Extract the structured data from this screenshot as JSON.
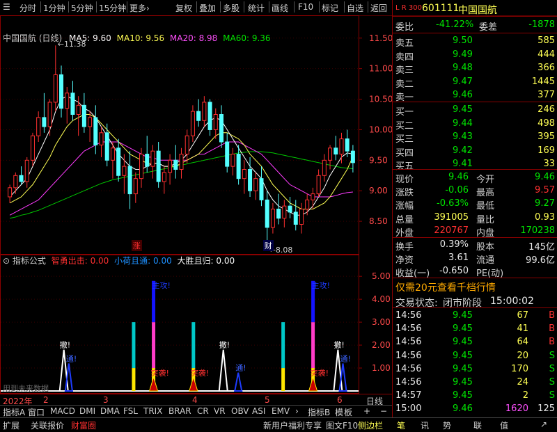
{
  "toolbar": {
    "left": [
      "分时",
      "1分钟",
      "5分钟",
      "15分钟",
      "更多›"
    ],
    "right": [
      "复权",
      "叠加",
      "多股",
      "统计",
      "画线",
      "F10",
      "标记",
      "自选",
      "返回"
    ]
  },
  "chart": {
    "title": "中国国航 (日线)",
    "legend": {
      "ma5": "MA5: 9.60",
      "ma10": "MA10: 9.56",
      "ma20": "MA20: 8.98",
      "ma60": "MA60: 9.36"
    },
    "high_marker": "11.38",
    "low_marker": "8.08",
    "badge_up": "涨",
    "badge_fin": "财",
    "ticks": [
      "11.50",
      "11.00",
      "10.50",
      "10.00",
      "9.50",
      "9.00",
      "8.50"
    ],
    "indicator_title": "指标公式",
    "indicator_legend": {
      "a": "智勇出击: 0.00",
      "b": "小荷且通: 0.00",
      "c": "大胜且归: 0.00"
    },
    "indicator_ticks": [
      "5.00",
      "4.00",
      "3.00",
      "2.00",
      "1.00"
    ],
    "future_note": "用到未来数据",
    "date_axis": [
      "2022年",
      "2",
      "3",
      "4",
      "5",
      "6"
    ],
    "period_label": "日线",
    "pm": [
      "+",
      "−"
    ]
  },
  "chart_data": {
    "type": "candlestick",
    "ylim": [
      8.0,
      11.6
    ],
    "ohlc": [
      [
        8.9,
        9.1,
        8.8,
        9.05
      ],
      [
        9.05,
        9.3,
        8.95,
        9.25
      ],
      [
        9.25,
        9.4,
        9.1,
        9.15
      ],
      [
        9.15,
        9.55,
        9.05,
        9.5
      ],
      [
        9.5,
        9.95,
        9.4,
        9.9
      ],
      [
        9.9,
        10.3,
        9.8,
        10.2
      ],
      [
        10.2,
        10.6,
        9.95,
        10.05
      ],
      [
        10.05,
        10.5,
        9.9,
        10.45
      ],
      [
        10.45,
        11.38,
        10.3,
        10.9
      ],
      [
        10.9,
        11.05,
        10.2,
        10.35
      ],
      [
        10.35,
        10.7,
        10.1,
        10.6
      ],
      [
        10.6,
        10.8,
        10.15,
        10.25
      ],
      [
        10.25,
        10.55,
        9.9,
        10.4
      ],
      [
        10.4,
        10.6,
        9.95,
        10.05
      ],
      [
        10.05,
        10.3,
        9.8,
        10.2
      ],
      [
        10.2,
        10.4,
        9.6,
        9.75
      ],
      [
        9.75,
        10.05,
        9.55,
        9.95
      ],
      [
        9.95,
        10.1,
        9.4,
        9.5
      ],
      [
        9.5,
        9.8,
        9.2,
        9.7
      ],
      [
        9.7,
        9.85,
        9.15,
        9.25
      ],
      [
        9.25,
        9.6,
        8.95,
        9.4
      ],
      [
        9.4,
        9.65,
        8.7,
        8.95
      ],
      [
        8.95,
        9.3,
        8.8,
        9.2
      ],
      [
        9.2,
        9.7,
        9.05,
        9.6
      ],
      [
        9.6,
        9.9,
        9.3,
        9.4
      ],
      [
        9.4,
        9.75,
        9.2,
        9.65
      ],
      [
        9.65,
        9.8,
        9.05,
        9.15
      ],
      [
        9.15,
        9.4,
        8.95,
        9.3
      ],
      [
        9.3,
        9.6,
        9.1,
        9.5
      ],
      [
        9.5,
        9.75,
        9.2,
        9.35
      ],
      [
        9.35,
        9.7,
        9.2,
        9.6
      ],
      [
        9.6,
        10.0,
        9.45,
        9.9
      ],
      [
        9.9,
        10.4,
        9.8,
        10.3
      ],
      [
        10.3,
        10.5,
        10.05,
        10.15
      ],
      [
        10.15,
        10.55,
        10.05,
        10.45
      ],
      [
        10.45,
        10.5,
        9.9,
        10.0
      ],
      [
        10.0,
        10.35,
        9.85,
        10.25
      ],
      [
        10.25,
        10.4,
        9.7,
        9.8
      ],
      [
        9.8,
        9.95,
        9.3,
        9.4
      ],
      [
        9.4,
        9.7,
        9.25,
        9.6
      ],
      [
        9.6,
        9.75,
        9.1,
        9.2
      ],
      [
        9.2,
        9.5,
        8.95,
        9.35
      ],
      [
        9.35,
        9.55,
        8.9,
        9.0
      ],
      [
        9.0,
        9.3,
        8.85,
        9.2
      ],
      [
        9.2,
        9.4,
        8.75,
        8.85
      ],
      [
        8.85,
        9.0,
        8.08,
        8.4
      ],
      [
        8.4,
        8.8,
        8.3,
        8.7
      ],
      [
        8.7,
        8.95,
        8.45,
        8.55
      ],
      [
        8.55,
        8.85,
        8.4,
        8.75
      ],
      [
        8.75,
        8.9,
        8.55,
        8.65
      ],
      [
        8.65,
        8.85,
        8.35,
        8.45
      ],
      [
        8.45,
        8.8,
        8.3,
        8.7
      ],
      [
        8.7,
        8.95,
        8.6,
        8.85
      ],
      [
        8.85,
        9.05,
        8.7,
        8.95
      ],
      [
        8.95,
        9.35,
        8.9,
        9.25
      ],
      [
        9.25,
        9.6,
        9.15,
        9.5
      ],
      [
        9.5,
        9.75,
        9.35,
        9.7
      ],
      [
        9.7,
        9.9,
        9.5,
        9.6
      ],
      [
        9.6,
        9.95,
        9.45,
        9.85
      ],
      [
        9.85,
        10.0,
        9.55,
        9.65
      ],
      [
        9.65,
        9.75,
        9.3,
        9.46
      ]
    ],
    "ma5": [
      8.9,
      9.0,
      9.1,
      9.2,
      9.4,
      9.6,
      9.8,
      10.0,
      10.3,
      10.5,
      10.55,
      10.5,
      10.45,
      10.35,
      10.3,
      10.2,
      10.05,
      9.9,
      9.75,
      9.6,
      9.5,
      9.4,
      9.35,
      9.35,
      9.4,
      9.45,
      9.45,
      9.4,
      9.4,
      9.45,
      9.5,
      9.6,
      9.75,
      9.9,
      10.05,
      10.15,
      10.2,
      10.15,
      10.0,
      9.85,
      9.7,
      9.55,
      9.4,
      9.3,
      9.2,
      9.0,
      8.85,
      8.75,
      8.7,
      8.65,
      8.6,
      8.6,
      8.65,
      8.75,
      8.9,
      9.05,
      9.25,
      9.4,
      9.55,
      9.62,
      9.6
    ],
    "ma10": [
      8.8,
      8.85,
      8.9,
      9.0,
      9.1,
      9.25,
      9.4,
      9.55,
      9.75,
      9.9,
      10.05,
      10.15,
      10.2,
      10.25,
      10.25,
      10.2,
      10.1,
      10.0,
      9.9,
      9.8,
      9.7,
      9.6,
      9.55,
      9.5,
      9.45,
      9.45,
      9.45,
      9.4,
      9.4,
      9.4,
      9.45,
      9.5,
      9.55,
      9.6,
      9.7,
      9.8,
      9.9,
      9.95,
      9.95,
      9.9,
      9.85,
      9.75,
      9.6,
      9.5,
      9.4,
      9.25,
      9.1,
      9.0,
      8.9,
      8.8,
      8.75,
      8.7,
      8.7,
      8.7,
      8.75,
      8.8,
      8.9,
      9.05,
      9.2,
      9.35,
      9.56
    ],
    "ma20": [
      8.6,
      8.65,
      8.7,
      8.75,
      8.8,
      8.85,
      8.95,
      9.05,
      9.15,
      9.25,
      9.35,
      9.45,
      9.55,
      9.65,
      9.7,
      9.75,
      9.8,
      9.8,
      9.8,
      9.8,
      9.75,
      9.7,
      9.65,
      9.6,
      9.55,
      9.55,
      9.5,
      9.5,
      9.5,
      9.5,
      9.5,
      9.5,
      9.55,
      9.6,
      9.6,
      9.65,
      9.7,
      9.75,
      9.8,
      9.8,
      9.8,
      9.75,
      9.7,
      9.65,
      9.6,
      9.5,
      9.4,
      9.3,
      9.2,
      9.1,
      9.05,
      9.0,
      8.95,
      8.9,
      8.9,
      8.9,
      8.9,
      8.92,
      8.95,
      8.97,
      8.98
    ],
    "ma60": [
      8.55,
      8.57,
      8.6,
      8.62,
      8.65,
      8.68,
      8.72,
      8.76,
      8.8,
      8.84,
      8.88,
      8.92,
      8.96,
      9.0,
      9.04,
      9.08,
      9.12,
      9.15,
      9.18,
      9.2,
      9.22,
      9.24,
      9.26,
      9.28,
      9.3,
      9.32,
      9.34,
      9.36,
      9.38,
      9.4,
      9.42,
      9.44,
      9.46,
      9.48,
      9.5,
      9.52,
      9.54,
      9.56,
      9.58,
      9.6,
      9.62,
      9.63,
      9.64,
      9.64,
      9.64,
      9.63,
      9.62,
      9.6,
      9.58,
      9.56,
      9.54,
      9.52,
      9.5,
      9.48,
      9.46,
      9.44,
      9.42,
      9.4,
      9.38,
      9.37,
      9.36
    ],
    "indicator": {
      "ylim": [
        0,
        5.4
      ],
      "bars": [
        {
          "i": 25,
          "v": 3.0,
          "color": "#00c8c8"
        },
        {
          "i": 29,
          "v": 3.0,
          "color": "#ff3cc8"
        },
        {
          "i": 29,
          "v": 4.8,
          "color": "#1414ff",
          "base": 3.0
        },
        {
          "i": 37,
          "v": 3.0,
          "color": "#00c8c8"
        },
        {
          "i": 55,
          "v": 3.0,
          "color": "#00c8c8"
        },
        {
          "i": 61,
          "v": 3.0,
          "color": "#ff3cc8"
        },
        {
          "i": 61,
          "v": 4.8,
          "color": "#1414ff",
          "base": 3.0
        }
      ],
      "spikes_white": [
        {
          "i": 11,
          "v": 1.8,
          "label": "撤!"
        },
        {
          "i": 43,
          "v": 1.8,
          "label": "撤!"
        },
        {
          "i": 66,
          "v": 1.8,
          "label": "撤!"
        }
      ],
      "spikes_blue": [
        {
          "i": 12,
          "v": 1.2,
          "label": "通!"
        },
        {
          "i": 46,
          "v": 0.8,
          "label": "通!"
        },
        {
          "i": 67,
          "v": 1.2,
          "label": "通!"
        }
      ],
      "red_labels": [
        {
          "i": 29,
          "label": "突袭!"
        },
        {
          "i": 37,
          "label": "突袭!"
        },
        {
          "i": 61,
          "label": "突袭!"
        }
      ],
      "attack_labels": [
        {
          "i": 29,
          "label": "主攻!"
        },
        {
          "i": 61,
          "label": "主攻!"
        }
      ]
    }
  },
  "quote": {
    "code": "601111",
    "name": "中国国航",
    "corner": "L R 300",
    "wb_label": "委比",
    "wb_value": "-41.22%",
    "wc_label": "委差",
    "wc_value": "-1878",
    "asks": [
      {
        "label": "卖五",
        "price": "9.50",
        "vol": "585"
      },
      {
        "label": "卖四",
        "price": "9.49",
        "vol": "444"
      },
      {
        "label": "卖三",
        "price": "9.48",
        "vol": "366"
      },
      {
        "label": "卖二",
        "price": "9.47",
        "vol": "1445"
      },
      {
        "label": "卖一",
        "price": "9.46",
        "vol": "377"
      }
    ],
    "bids": [
      {
        "label": "买一",
        "price": "9.45",
        "vol": "246"
      },
      {
        "label": "买二",
        "price": "9.44",
        "vol": "498"
      },
      {
        "label": "买三",
        "price": "9.43",
        "vol": "395"
      },
      {
        "label": "买四",
        "price": "9.42",
        "vol": "169"
      },
      {
        "label": "买五",
        "price": "9.41",
        "vol": "33"
      }
    ],
    "stats": [
      {
        "l1": "现价",
        "v1": "9.46",
        "c1": "grn",
        "l2": "今开",
        "v2": "9.46",
        "c2": "grn"
      },
      {
        "l1": "涨跌",
        "v1": "-0.06",
        "c1": "grn",
        "l2": "最高",
        "v2": "9.57",
        "c2": "red"
      },
      {
        "l1": "涨幅",
        "v1": "-0.63%",
        "c1": "grn",
        "l2": "最低",
        "v2": "9.27",
        "c2": "grn"
      },
      {
        "l1": "总量",
        "v1": "391005",
        "c1": "yel",
        "l2": "量比",
        "v2": "0.93",
        "c2": "yel"
      },
      {
        "l1": "外盘",
        "v1": "220767",
        "c1": "red",
        "l2": "内盘",
        "v2": "170238",
        "c2": "grn"
      }
    ],
    "stats2": [
      {
        "l1": "换手",
        "v1": "0.39%",
        "l2": "股本",
        "v2": "145亿"
      },
      {
        "l1": "净资",
        "v1": "3.61",
        "l2": "流通",
        "v2": "99.6亿"
      },
      {
        "l1": "收益(一)",
        "v1": "-0.650",
        "l2": "PE(动)",
        "v2": ""
      }
    ],
    "promo": "仅需20元查看千档行情",
    "status_label": "交易状态:",
    "status_value": "闭市阶段",
    "status_time": "15:00:02",
    "ticks": [
      {
        "t": "14:56",
        "p": "9.45",
        "v": "67",
        "s": "B"
      },
      {
        "t": "14:56",
        "p": "9.45",
        "v": "41",
        "s": "B"
      },
      {
        "t": "14:56",
        "p": "9.45",
        "v": "64",
        "s": "B"
      },
      {
        "t": "14:56",
        "p": "9.45",
        "v": "20",
        "s": "S"
      },
      {
        "t": "14:56",
        "p": "9.45",
        "v": "170",
        "s": "S"
      },
      {
        "t": "14:56",
        "p": "9.45",
        "v": "24",
        "s": "S"
      },
      {
        "t": "14:57",
        "p": "9.45",
        "v": "2",
        "s": "S"
      },
      {
        "t": "15:00",
        "p": "9.46",
        "v": "1620",
        "s": "125"
      }
    ]
  },
  "tabs": [
    "指标A",
    "窗口",
    "MACD",
    "DMI",
    "DMA",
    "FSL",
    "TRIX",
    "BRAR",
    "CR",
    "VR",
    "OBV",
    "ASI",
    "EMV",
    "›",
    "指标B",
    "模",
    "板",
    "+"
  ],
  "bottom": {
    "left": [
      "扩展",
      "关联报价",
      "财富圈"
    ],
    "right": [
      "新用户福利专享",
      "图文F10",
      "侧边栏"
    ],
    "right_icons": [
      "笔",
      "讯",
      "势",
      "联",
      "值",
      "↗"
    ]
  }
}
